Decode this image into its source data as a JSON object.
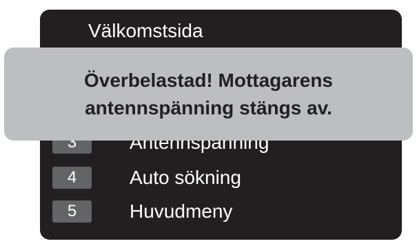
{
  "screen": {
    "title": "Välkomstsida",
    "background_color": "#231f20",
    "number_badge_color": "#636466"
  },
  "menu": {
    "items": [
      {
        "number": "3",
        "label": "Antennspänning"
      },
      {
        "number": "4",
        "label": "Auto sökning"
      },
      {
        "number": "5",
        "label": "Huvudmeny"
      }
    ]
  },
  "popup": {
    "background_color": "#bcbec0",
    "line1": "Överbelastad! Mottagarens",
    "line2": "antennspänning stängs av."
  }
}
